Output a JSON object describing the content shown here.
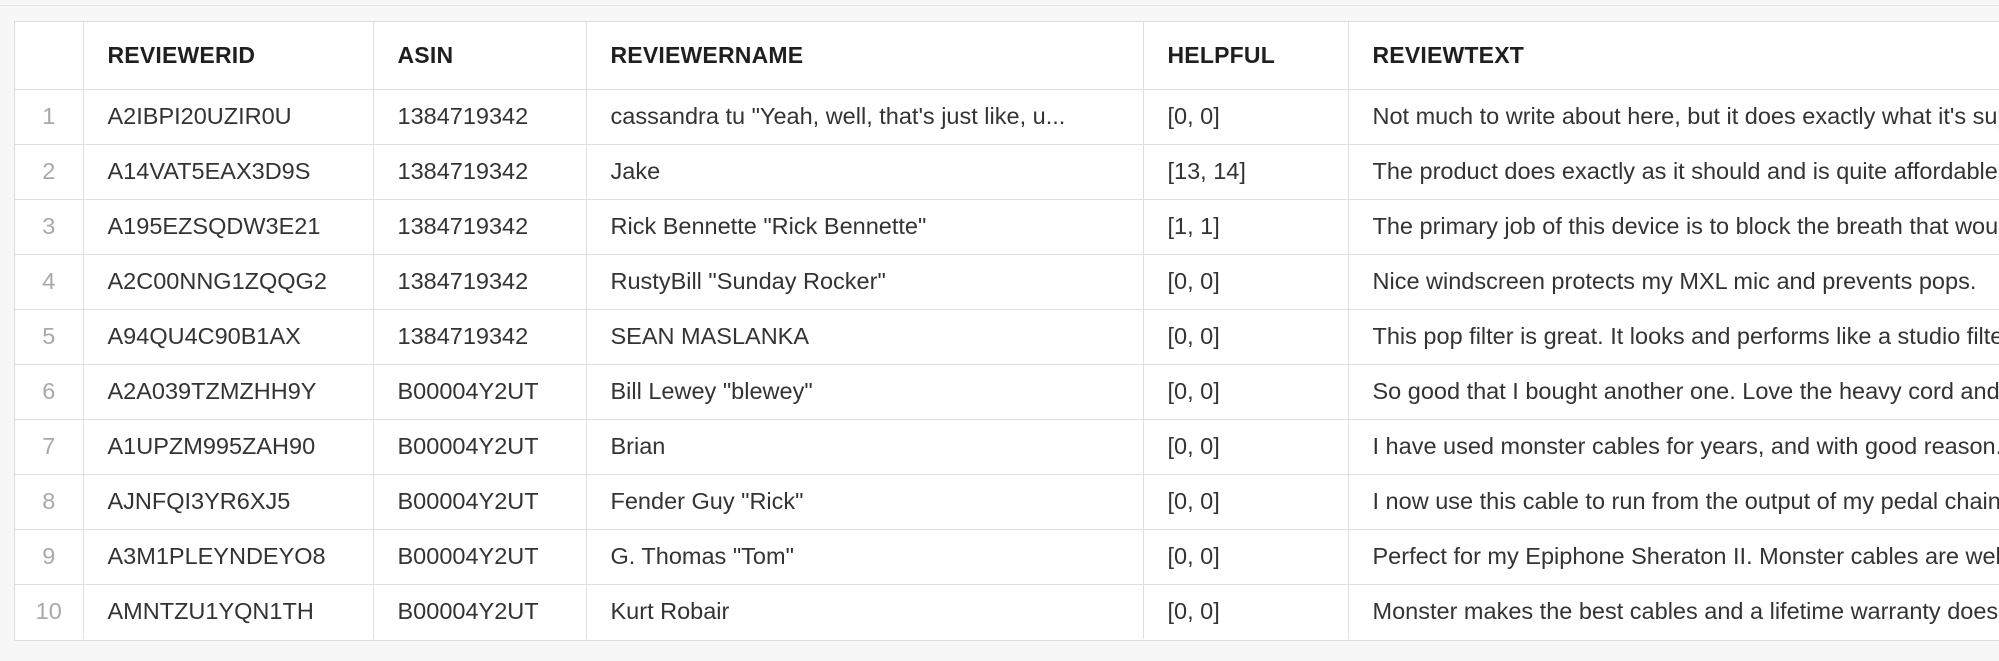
{
  "table": {
    "columns": [
      {
        "key": "idx",
        "label": ""
      },
      {
        "key": "reviewerid",
        "label": "REVIEWERID"
      },
      {
        "key": "asin",
        "label": "ASIN"
      },
      {
        "key": "reviewername",
        "label": "REVIEWERNAME"
      },
      {
        "key": "helpful",
        "label": "HELPFUL"
      },
      {
        "key": "reviewtext",
        "label": "REVIEWTEXT"
      }
    ],
    "rows": [
      {
        "idx": "1",
        "reviewerid": "A2IBPI20UZIR0U",
        "asin": "1384719342",
        "reviewername": "cassandra tu \"Yeah, well, that's just like, u...",
        "helpful": "[0, 0]",
        "reviewtext": "Not much to write about here, but it does exactly what it's supposed to."
      },
      {
        "idx": "2",
        "reviewerid": "A14VAT5EAX3D9S",
        "asin": "1384719342",
        "reviewername": "Jake",
        "helpful": "[13, 14]",
        "reviewtext": "The product does exactly as it should and is quite affordable."
      },
      {
        "idx": "3",
        "reviewerid": "A195EZSQDW3E21",
        "asin": "1384719342",
        "reviewername": "Rick Bennette \"Rick Bennette\"",
        "helpful": "[1, 1]",
        "reviewtext": "The primary job of this device is to block the breath that would"
      },
      {
        "idx": "4",
        "reviewerid": "A2C00NNG1ZQQG2",
        "asin": "1384719342",
        "reviewername": "RustyBill \"Sunday Rocker\"",
        "helpful": "[0, 0]",
        "reviewtext": "Nice windscreen protects my MXL mic and prevents pops."
      },
      {
        "idx": "5",
        "reviewerid": "A94QU4C90B1AX",
        "asin": "1384719342",
        "reviewername": "SEAN MASLANKA",
        "helpful": "[0, 0]",
        "reviewtext": "This pop filter is great. It looks and performs like a studio filter."
      },
      {
        "idx": "6",
        "reviewerid": "A2A039TZMZHH9Y",
        "asin": "B00004Y2UT",
        "reviewername": "Bill Lewey \"blewey\"",
        "helpful": "[0, 0]",
        "reviewtext": "So good that I bought another one.  Love the heavy cord and gold connectors."
      },
      {
        "idx": "7",
        "reviewerid": "A1UPZM995ZAH90",
        "asin": "B00004Y2UT",
        "reviewername": "Brian",
        "helpful": "[0, 0]",
        "reviewtext": "I have used monster cables for years, and with good reason."
      },
      {
        "idx": "8",
        "reviewerid": "AJNFQI3YR6XJ5",
        "asin": "B00004Y2UT",
        "reviewername": "Fender Guy \"Rick\"",
        "helpful": "[0, 0]",
        "reviewtext": "I now use this cable to run from the output of my pedal chain."
      },
      {
        "idx": "9",
        "reviewerid": "A3M1PLEYNDEYO8",
        "asin": "B00004Y2UT",
        "reviewername": "G. Thomas \"Tom\"",
        "helpful": "[0, 0]",
        "reviewtext": "Perfect for my Epiphone Sheraton II.  Monster cables are well constructed."
      },
      {
        "idx": "10",
        "reviewerid": "AMNTZU1YQN1TH",
        "asin": "B00004Y2UT",
        "reviewername": "Kurt Robair",
        "helpful": "[0, 0]",
        "reviewtext": "Monster makes the best cables and a lifetime warranty doesn't hurt either."
      }
    ]
  }
}
